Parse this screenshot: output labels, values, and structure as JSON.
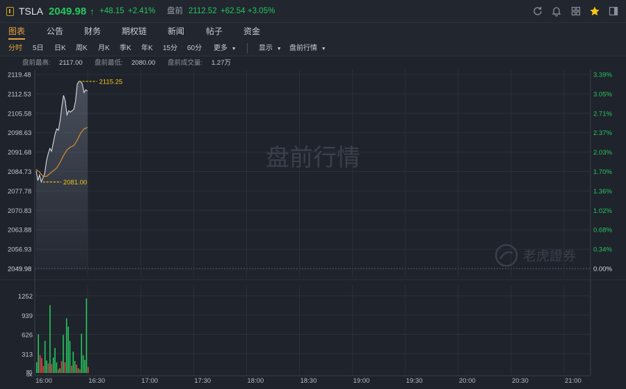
{
  "header": {
    "symbol": "TSLA",
    "price": "2049.98",
    "arrow": "↑",
    "change": "+48.15",
    "change_pct": "+2.41%",
    "premarket_label": "盘前",
    "premarket_price": "2112.52",
    "premarket_change": "+62.54",
    "premarket_change_pct": "+3.05%",
    "right_icons": [
      "refresh-icon",
      "bell-icon",
      "grid-icon",
      "star-icon",
      "sidebar-toggle-icon"
    ]
  },
  "tabs": [
    {
      "label": "图表",
      "active": true
    },
    {
      "label": "公告"
    },
    {
      "label": "财务"
    },
    {
      "label": "期权链"
    },
    {
      "label": "新闻"
    },
    {
      "label": "帖子"
    },
    {
      "label": "资金"
    }
  ],
  "toolbar": {
    "periods": [
      {
        "label": "分时",
        "active": true
      },
      {
        "label": "5日"
      },
      {
        "label": "日K"
      },
      {
        "label": "周K"
      },
      {
        "label": "月K"
      },
      {
        "label": "季K"
      },
      {
        "label": "年K"
      },
      {
        "label": "15分"
      },
      {
        "label": "60分"
      }
    ],
    "more": "更多",
    "display": "显示",
    "premarket_quotes": "盘前行情"
  },
  "stats": {
    "high_label": "盘前最高:",
    "high_value": "2117.00",
    "low_label": "盘前最低:",
    "low_value": "2080.00",
    "volume_label": "盘前成交量:",
    "volume_value": "1.27万"
  },
  "watermark": "盘前行情",
  "brand_watermark": "老虎證券",
  "colors": {
    "up": "#24c85c",
    "down": "#e34a4a",
    "accent": "#e8a43c",
    "marker": "#f0c419",
    "price_line": "#d9dde4",
    "avg_line": "#e8922e"
  },
  "chart_data": {
    "type": "line",
    "y_left_ticks": [
      "2119.48",
      "2112.53",
      "2105.58",
      "2098.63",
      "2091.68",
      "2084.73",
      "2077.78",
      "2070.83",
      "2063.88",
      "2056.93",
      "2049.98"
    ],
    "y_right_ticks": [
      "3.39%",
      "3.05%",
      "2.71%",
      "2.37%",
      "2.03%",
      "1.70%",
      "1.36%",
      "1.02%",
      "0.68%",
      "0.34%",
      "0.00%"
    ],
    "ylim": [
      2049.98,
      2119.48
    ],
    "x_ticks": [
      "16:00",
      "16:30",
      "17:00",
      "17:30",
      "18:00",
      "18:30",
      "19:00",
      "19:30",
      "20:00",
      "20:30",
      "21:00"
    ],
    "x_minutes_range": [
      0,
      330
    ],
    "max_marker": {
      "x_min": 25,
      "value": 2117.0,
      "label": "2115.25"
    },
    "min_marker": {
      "x_min": 4,
      "value": 2081.0,
      "label": "2081.00"
    },
    "series": [
      {
        "kind": "price",
        "x": [
          0,
          1,
          2,
          3,
          4,
          5,
          6,
          7,
          8,
          9,
          10,
          11,
          12,
          13,
          14,
          15,
          16,
          17,
          18,
          19,
          20,
          21,
          22,
          23,
          24,
          25,
          26,
          27,
          28,
          29,
          30
        ],
        "values": [
          2085.0,
          2081.5,
          2083.5,
          2081.0,
          2082.5,
          2084.0,
          2088.5,
          2091.0,
          2093.0,
          2092.0,
          2095.0,
          2098.0,
          2100.0,
          2099.5,
          2103.0,
          2108.0,
          2112.0,
          2110.0,
          2105.0,
          2106.5,
          2106.0,
          2106.5,
          2107.0,
          2110.0,
          2116.0,
          2117.0,
          2117.0,
          2116.0,
          2113.0,
          2114.0,
          2113.5
        ]
      },
      {
        "kind": "average",
        "x": [
          0,
          2,
          4,
          6,
          8,
          10,
          12,
          14,
          16,
          18,
          20,
          22,
          24,
          26,
          28,
          30
        ],
        "values": [
          2085.5,
          2084.5,
          2083.0,
          2083.0,
          2084.0,
          2085.0,
          2086.0,
          2088.0,
          2090.5,
          2092.5,
          2093.5,
          2094.0,
          2096.0,
          2098.5,
          2100.0,
          2100.5
        ]
      }
    ],
    "volume": {
      "y_ticks": [
        "1252",
        "939",
        "626",
        "313",
        "股"
      ],
      "ylim": [
        0,
        1252
      ],
      "bars": [
        {
          "x": 0,
          "v": 180,
          "up": true
        },
        {
          "x": 1,
          "v": 650,
          "up": true
        },
        {
          "x": 2,
          "v": 300,
          "up": false
        },
        {
          "x": 3,
          "v": 250,
          "up": false
        },
        {
          "x": 4,
          "v": 120,
          "up": false
        },
        {
          "x": 5,
          "v": 540,
          "up": true
        },
        {
          "x": 6,
          "v": 210,
          "up": true
        },
        {
          "x": 7,
          "v": 160,
          "up": false
        },
        {
          "x": 8,
          "v": 1140,
          "up": true
        },
        {
          "x": 9,
          "v": 150,
          "up": false
        },
        {
          "x": 10,
          "v": 260,
          "up": true
        },
        {
          "x": 11,
          "v": 420,
          "up": true
        },
        {
          "x": 12,
          "v": 180,
          "up": true
        },
        {
          "x": 13,
          "v": 60,
          "up": false
        },
        {
          "x": 14,
          "v": 80,
          "up": true
        },
        {
          "x": 15,
          "v": 200,
          "up": false
        },
        {
          "x": 16,
          "v": 640,
          "up": true
        },
        {
          "x": 17,
          "v": 180,
          "up": false
        },
        {
          "x": 18,
          "v": 920,
          "up": true
        },
        {
          "x": 19,
          "v": 780,
          "up": true
        },
        {
          "x": 20,
          "v": 540,
          "up": true
        },
        {
          "x": 21,
          "v": 120,
          "up": false
        },
        {
          "x": 22,
          "v": 360,
          "up": true
        },
        {
          "x": 23,
          "v": 200,
          "up": true
        },
        {
          "x": 24,
          "v": 140,
          "up": false
        },
        {
          "x": 25,
          "v": 80,
          "up": true
        },
        {
          "x": 26,
          "v": 60,
          "up": false
        },
        {
          "x": 27,
          "v": 660,
          "up": true
        },
        {
          "x": 28,
          "v": 300,
          "up": true
        },
        {
          "x": 29,
          "v": 220,
          "up": true
        },
        {
          "x": 30,
          "v": 1252,
          "up": true
        },
        {
          "x": 31,
          "v": 100,
          "up": false
        }
      ]
    }
  }
}
